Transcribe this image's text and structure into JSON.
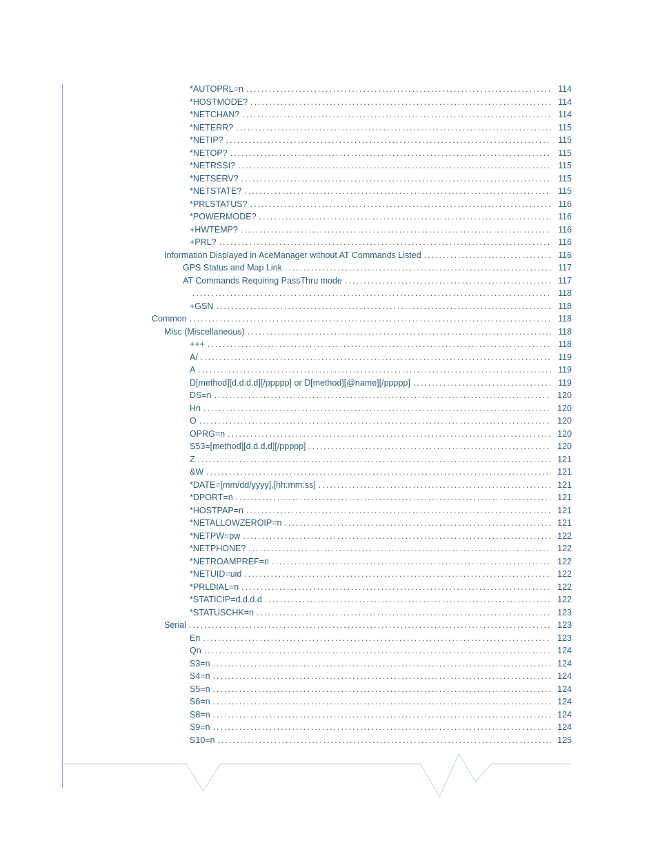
{
  "toc": [
    {
      "level": 4,
      "label": "*AUTOPRL=n",
      "page": "114"
    },
    {
      "level": 4,
      "label": "*HOSTMODE?",
      "page": "114"
    },
    {
      "level": 4,
      "label": "*NETCHAN?",
      "page": "114"
    },
    {
      "level": 4,
      "label": "*NETERR?",
      "page": "115"
    },
    {
      "level": 4,
      "label": "*NETIP?",
      "page": "115"
    },
    {
      "level": 4,
      "label": "*NETOP?",
      "page": "115"
    },
    {
      "level": 4,
      "label": "*NETRSSI?",
      "page": "115"
    },
    {
      "level": 4,
      "label": "*NETSERV?",
      "page": "115"
    },
    {
      "level": 4,
      "label": "*NETSTATE?",
      "page": "115"
    },
    {
      "level": 4,
      "label": "*PRLSTATUS?",
      "page": "116"
    },
    {
      "level": 4,
      "label": "*POWERMODE?",
      "page": "116"
    },
    {
      "level": 4,
      "label": "+HWTEMP?",
      "page": "116"
    },
    {
      "level": 4,
      "label": "+PRL?",
      "page": "116"
    },
    {
      "level": 2,
      "label": "Information Displayed in AceManager without AT Commands Listed",
      "page": "116"
    },
    {
      "level": 3,
      "label": "GPS Status and Map Link",
      "page": "117"
    },
    {
      "level": 3,
      "label": "AT Commands Requiring PassThru mode",
      "page": "117"
    },
    {
      "level": 4,
      "label": "",
      "page": "118"
    },
    {
      "level": 4,
      "label": "+GSN",
      "page": "118"
    },
    {
      "level": 1,
      "label": "Common",
      "page": "118"
    },
    {
      "level": 2,
      "label": "Misc (Miscellaneous)",
      "page": "118"
    },
    {
      "level": 4,
      "label": "+++",
      "page": "118"
    },
    {
      "level": 4,
      "label": "A/",
      "page": "119"
    },
    {
      "level": 4,
      "label": "A",
      "page": "119"
    },
    {
      "level": 4,
      "label": "D[method][d.d.d.d][/ppppp] or D[method][@name][/ppppp]",
      "page": "119"
    },
    {
      "level": 4,
      "label": "DS=n",
      "page": "120"
    },
    {
      "level": 4,
      "label": "Hn",
      "page": "120"
    },
    {
      "level": 4,
      "label": "O",
      "page": "120"
    },
    {
      "level": 4,
      "label": "OPRG=n",
      "page": "120"
    },
    {
      "level": 4,
      "label": "S53=[method][d.d.d.d][/ppppp]",
      "page": "120"
    },
    {
      "level": 4,
      "label": "Z",
      "page": "121"
    },
    {
      "level": 4,
      "label": "&W",
      "page": "121"
    },
    {
      "level": 4,
      "label": "*DATE=[mm/dd/yyyy],[hh:mm:ss]",
      "page": "121"
    },
    {
      "level": 4,
      "label": "*DPORT=n",
      "page": "121"
    },
    {
      "level": 4,
      "label": "*HOSTPAP=n",
      "page": "121"
    },
    {
      "level": 4,
      "label": "*NETALLOWZEROIP=n",
      "page": "121"
    },
    {
      "level": 4,
      "label": "*NETPW=pw",
      "page": "122"
    },
    {
      "level": 4,
      "label": "*NETPHONE?",
      "page": "122"
    },
    {
      "level": 4,
      "label": "*NETROAMPREF=n",
      "page": "122"
    },
    {
      "level": 4,
      "label": "*NETUID=uid",
      "page": "122"
    },
    {
      "level": 4,
      "label": "*PRLDIAL=n",
      "page": "122"
    },
    {
      "level": 4,
      "label": "*STATICIP=d.d.d.d",
      "page": "122"
    },
    {
      "level": 4,
      "label": "*STATUSCHK=n",
      "page": "123"
    },
    {
      "level": 2,
      "label": "Serial",
      "page": "123"
    },
    {
      "level": 4,
      "label": "En",
      "page": "123"
    },
    {
      "level": 4,
      "label": "Qn",
      "page": "124"
    },
    {
      "level": 4,
      "label": "S3=n",
      "page": "124"
    },
    {
      "level": 4,
      "label": "S4=n",
      "page": "124"
    },
    {
      "level": 4,
      "label": "S5=n",
      "page": "124"
    },
    {
      "level": 4,
      "label": "S6=n",
      "page": "124"
    },
    {
      "level": 4,
      "label": "S8=n",
      "page": "124"
    },
    {
      "level": 4,
      "label": "S9=n",
      "page": "124"
    },
    {
      "level": 4,
      "label": "S10=n",
      "page": "125"
    }
  ]
}
